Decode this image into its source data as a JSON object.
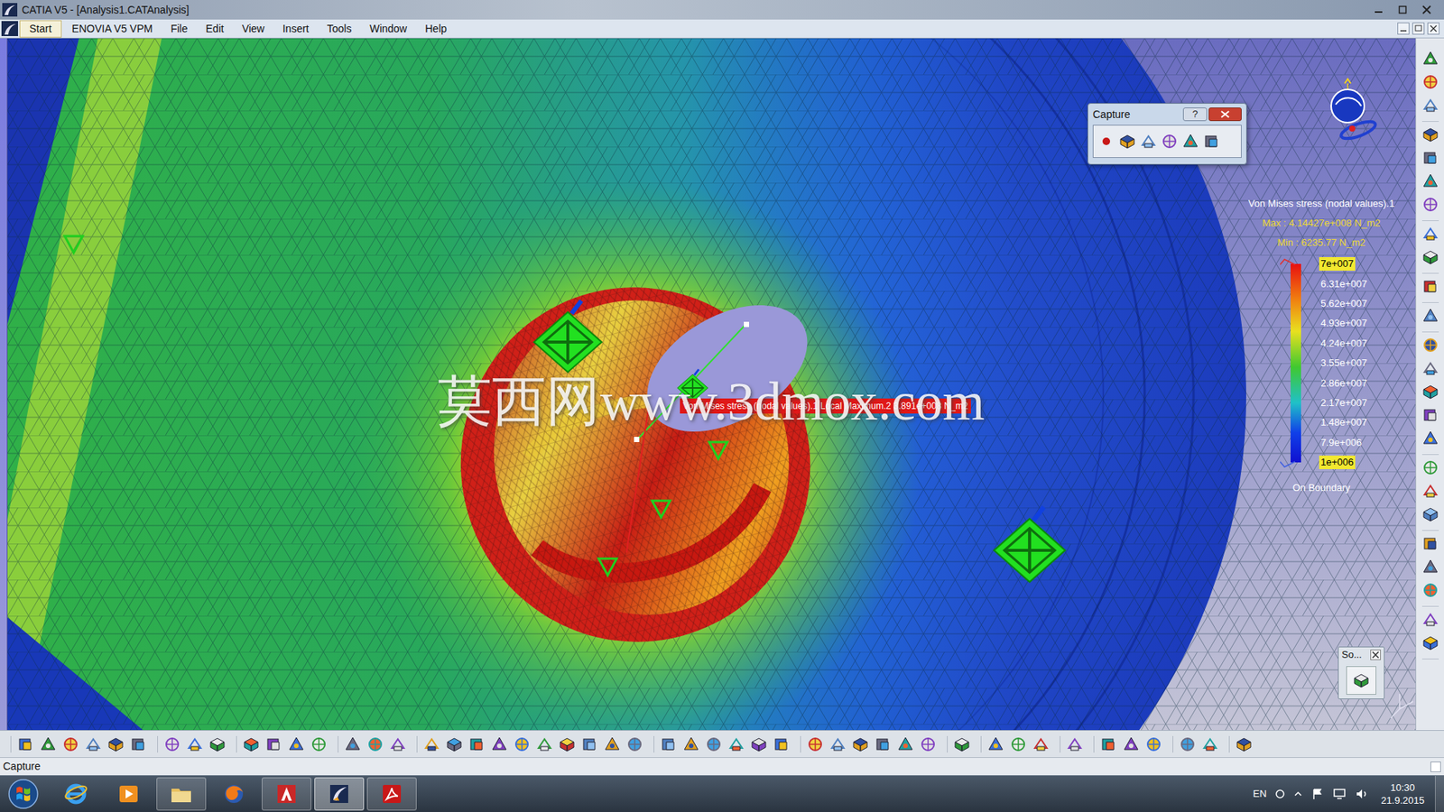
{
  "window": {
    "title": "CATIA V5 - [Analysis1.CATAnalysis]"
  },
  "menu": [
    {
      "label": "Start",
      "selected": true
    },
    {
      "label": "ENOVIA V5 VPM",
      "selected": false
    },
    {
      "label": "File",
      "selected": false
    },
    {
      "label": "Edit",
      "selected": false
    },
    {
      "label": "View",
      "selected": false
    },
    {
      "label": "Insert",
      "selected": false
    },
    {
      "label": "Tools",
      "selected": false
    },
    {
      "label": "Window",
      "selected": false
    },
    {
      "label": "Help",
      "selected": false
    }
  ],
  "viewport": {
    "callout": "Von Mises stress (nodal values).1 Local Maximum.2 3.891e+008 N_m2",
    "watermark": "莫西网www.3dmox.com"
  },
  "legend": {
    "title": "Von Mises stress (nodal values).1",
    "max": "Max : 4.14427e+008 N_m2",
    "min": "Min : 6235.77 N_m2",
    "ticks": [
      {
        "label": "7e+007",
        "highlighted": true
      },
      {
        "label": "6.31e+007",
        "highlighted": false
      },
      {
        "label": "5.62e+007",
        "highlighted": false
      },
      {
        "label": "4.93e+007",
        "highlighted": false
      },
      {
        "label": "4.24e+007",
        "highlighted": false
      },
      {
        "label": "3.55e+007",
        "highlighted": false
      },
      {
        "label": "2.86e+007",
        "highlighted": false
      },
      {
        "label": "2.17e+007",
        "highlighted": false
      },
      {
        "label": "1.48e+007",
        "highlighted": false
      },
      {
        "label": "7.9e+006",
        "highlighted": false
      },
      {
        "label": "1e+006",
        "highlighted": true
      }
    ],
    "footer": "On Boundary"
  },
  "capture_dialog": {
    "title": "Capture",
    "help": "?"
  },
  "mini_toolbar": {
    "title": "So..."
  },
  "status_bar": {
    "text": "Capture"
  },
  "taskbar": {
    "apps": [
      {
        "kind": "ie",
        "running": false,
        "selected": false
      },
      {
        "kind": "media",
        "running": false,
        "selected": false
      },
      {
        "kind": "explorer",
        "running": true,
        "selected": false
      },
      {
        "kind": "firefox",
        "running": false,
        "selected": false
      },
      {
        "kind": "autodesk",
        "running": true,
        "selected": false
      },
      {
        "kind": "catia",
        "running": true,
        "selected": true
      },
      {
        "kind": "acrobat",
        "running": true,
        "selected": false
      }
    ],
    "language": "EN",
    "time": "10:30",
    "date": "21.9.2015"
  }
}
